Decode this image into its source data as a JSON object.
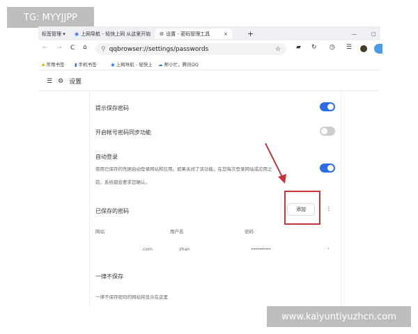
{
  "overlay": {
    "top_left": "TG: MYYJJPP",
    "bottom_right": "www.kaiyuntiyuzhcn.com"
  },
  "tabs": {
    "group": "标签管理 ▾",
    "items": [
      {
        "label": "上网导航 - 轻快上网 从这里开始"
      },
      {
        "label": "设置 - 密码管理工具",
        "active": true
      }
    ],
    "close": "×",
    "new": "+"
  },
  "address": {
    "url": "qqbrowser://settings/passwords"
  },
  "bookmarks": [
    "常用书签",
    "手机书签",
    "上网导航 - 轻快上",
    "帮小忙，腾讯QQ"
  ],
  "header": {
    "title": "设置"
  },
  "settings": {
    "offer_save": "提示保存密码",
    "offer_save_on": true,
    "sync": "开启帐号密码同步功能",
    "sync_on": false,
    "auto_login": "自动登录",
    "auto_login_desc_1": "使用已保存的凭据自动登录网站和应用。如果关闭了该功能，在您每次登录网站或应用之",
    "auto_login_desc_2": "前，系统都会要求您确认。",
    "auto_login_on": true
  },
  "saved": {
    "title": "已保存的密码",
    "add_label": "添加",
    "columns": [
      "网站",
      "用户名",
      "密码"
    ],
    "rows": [
      {
        "site": ".com",
        "user": "zhan",
        "password": "••••••••••"
      }
    ]
  },
  "never": {
    "title": "一律不保存",
    "empty": "一律不保存密码的网站将显示在这里"
  },
  "colors": {
    "accent": "#2d6ee6",
    "highlight": "#c8343c"
  }
}
